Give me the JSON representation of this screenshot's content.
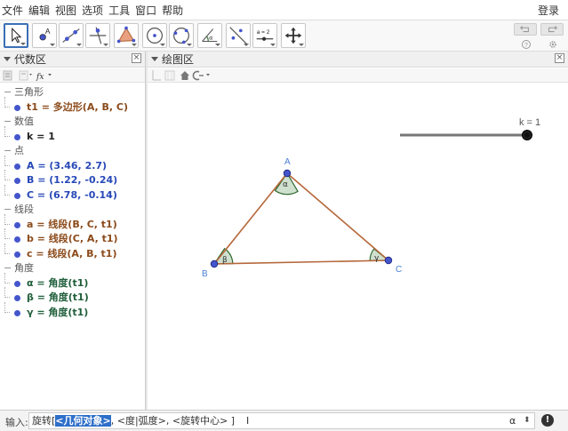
{
  "menu": {
    "items": [
      "文件",
      "编辑",
      "视图",
      "选项",
      "工具",
      "窗口",
      "帮助"
    ],
    "login": "登录"
  },
  "toolbar": {
    "tools": [
      "move-tool",
      "point-tool",
      "line-tool",
      "perpendicular-line-tool",
      "polygon-tool",
      "circle-center-point-tool",
      "circle-three-points-tool",
      "angle-tool",
      "reflect-tool",
      "slider-tool",
      "move-graphics-view-tool"
    ],
    "slider_tool_label": "a = 2",
    "angle_tool_label": "α"
  },
  "algebra_view": {
    "title": "代数区",
    "groups": [
      {
        "category": "三角形",
        "items": [
          {
            "text": "t1 = 多边形(A, B, C)",
            "color": "brown"
          }
        ]
      },
      {
        "category": "数值",
        "items": [
          {
            "text": "k = 1",
            "color": "black"
          }
        ]
      },
      {
        "category": "点",
        "items": [
          {
            "text": "A = (3.46, 2.7)",
            "color": "blue"
          },
          {
            "text": "B = (1.22, -0.24)",
            "color": "blue"
          },
          {
            "text": "C = (6.78, -0.14)",
            "color": "blue"
          }
        ]
      },
      {
        "category": "线段",
        "items": [
          {
            "text": "a = 线段(B, C, t1)",
            "color": "brown"
          },
          {
            "text": "b = 线段(C, A, t1)",
            "color": "brown"
          },
          {
            "text": "c = 线段(A, B, t1)",
            "color": "brown"
          }
        ]
      },
      {
        "category": "角度",
        "items": [
          {
            "text": "α = 角度(t1)",
            "color": "teal"
          },
          {
            "text": "β = 角度(t1)",
            "color": "teal"
          },
          {
            "text": "γ = 角度(t1)",
            "color": "teal"
          }
        ]
      }
    ]
  },
  "graphics_view": {
    "title": "绘图区",
    "slider_label": "k = 1",
    "points": {
      "A": "A",
      "B": "B",
      "C": "C"
    },
    "angles": {
      "alpha": "α",
      "beta": "β",
      "gamma": "γ"
    }
  },
  "input_bar": {
    "label": "输入:",
    "highlighted": "<几何对象>",
    "prefix": "旋转[",
    "rest": ", <度|弧度>, <旋转中心> ]",
    "alpha_button": "α",
    "help": "!"
  },
  "colors": {
    "accent": "#3b6fb6",
    "segment": "#b5673a",
    "point_fill": "#4455cc",
    "angle_fill": "#cfe0cf",
    "angle_stroke": "#2f6a2f",
    "input_highlight": "#2e6fc9"
  }
}
